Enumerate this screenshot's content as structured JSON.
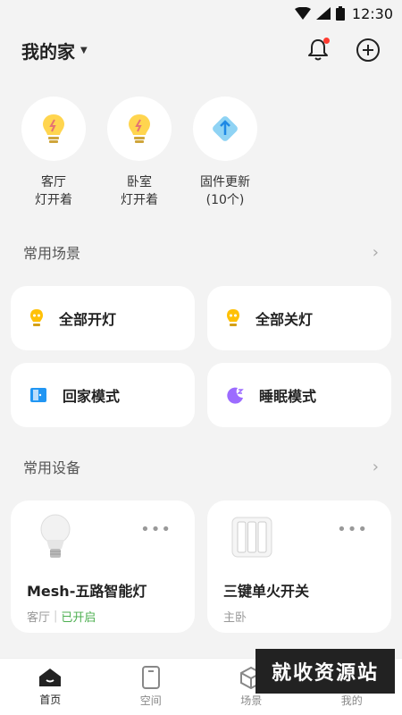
{
  "status_bar": {
    "time": "12:30"
  },
  "header": {
    "home_name": "我的家"
  },
  "quick_items": [
    {
      "line1": "客厅",
      "line2": "灯开着",
      "icon": "bulb-icon"
    },
    {
      "line1": "卧室",
      "line2": "灯开着",
      "icon": "bulb-icon"
    },
    {
      "line1": "固件更新",
      "line2": "(10个)",
      "icon": "firmware-update-icon"
    }
  ],
  "scenes_section": {
    "title": "常用场景"
  },
  "scenes": [
    {
      "label": "全部开灯",
      "icon": "bulb-small-icon"
    },
    {
      "label": "全部关灯",
      "icon": "bulb-small-icon"
    },
    {
      "label": "回家模式",
      "icon": "door-icon"
    },
    {
      "label": "睡眠模式",
      "icon": "moon-icon"
    }
  ],
  "devices_section": {
    "title": "常用设备"
  },
  "devices": [
    {
      "name": "Mesh-五路智能灯",
      "room": "客厅",
      "status": "已开启",
      "icon": "smart-bulb-icon"
    },
    {
      "name": "三键单火开关",
      "room": "主卧",
      "status": "",
      "icon": "triple-switch-icon"
    }
  ],
  "tabs": [
    {
      "label": "首页",
      "active": true
    },
    {
      "label": "空间",
      "active": false
    },
    {
      "label": "场景",
      "active": false
    },
    {
      "label": "我的",
      "active": false
    }
  ],
  "watermark": "就收资源站",
  "colors": {
    "accent_green": "#4caf50",
    "notification": "#ff3b30",
    "bulb_yellow": "#ffd54f",
    "scene_blue": "#2196f3",
    "scene_purple": "#9c6bff"
  }
}
